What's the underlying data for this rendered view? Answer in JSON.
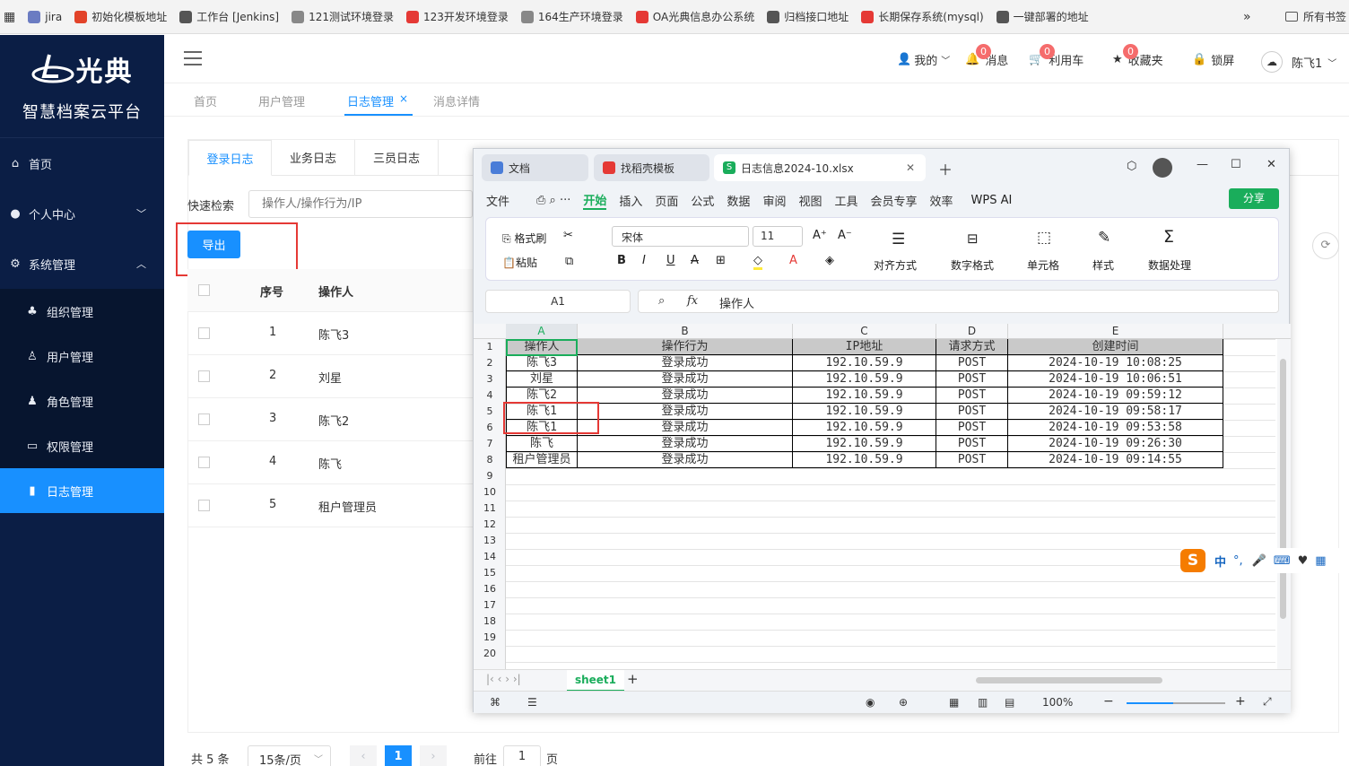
{
  "bookmarks": [
    "jira",
    "初始化模板地址",
    "工作台 [Jenkins]",
    "121测试环境登录",
    "123开发环境登录",
    "164生产环境登录",
    "OA光典信息办公系统",
    "归档接口地址",
    "长期保存系统(mysql)",
    "一键部署的地址"
  ],
  "bookmarks_more": "»",
  "bookmarks_all": "所有书签",
  "brand": {
    "logo": "光典",
    "platform": "智慧档案云平台"
  },
  "sidebar": {
    "items": [
      {
        "label": "首页"
      },
      {
        "label": "个人中心"
      },
      {
        "label": "系统管理"
      }
    ],
    "sub": [
      {
        "label": "组织管理"
      },
      {
        "label": "用户管理"
      },
      {
        "label": "角色管理"
      },
      {
        "label": "权限管理"
      },
      {
        "label": "日志管理"
      }
    ]
  },
  "header": {
    "mine": "我的",
    "messages": "消息",
    "utilize": "利用车",
    "favorites": "收藏夹",
    "lock": "锁屏",
    "user": "陈飞1",
    "badge_messages": "0",
    "badge_utilize": "0",
    "badge_favorites": "0"
  },
  "page_tabs": [
    "首页",
    "用户管理",
    "日志管理",
    "消息详情"
  ],
  "page_tab_close": "×",
  "log_tabs": [
    "登录日志",
    "业务日志",
    "三员日志"
  ],
  "search": {
    "label": "快速检索",
    "placeholder": "操作人/操作行为/IP"
  },
  "export_label": "导出",
  "table": {
    "headers": [
      "序号",
      "操作人"
    ],
    "rows": [
      {
        "no": "1",
        "user": "陈飞3"
      },
      {
        "no": "2",
        "user": "刘星"
      },
      {
        "no": "3",
        "user": "陈飞2"
      },
      {
        "no": "4",
        "user": "陈飞"
      },
      {
        "no": "5",
        "user": "租户管理员"
      }
    ]
  },
  "pagination": {
    "total": "共 5 条",
    "page_size": "15条/页",
    "current": "1",
    "goto": "前往",
    "goto_value": "1",
    "page_suffix": "页"
  },
  "wps": {
    "tabs": [
      "文档",
      "找稻壳模板",
      "日志信息2024-10.xlsx"
    ],
    "menu": [
      "文件",
      "开始",
      "插入",
      "页面",
      "公式",
      "数据",
      "审阅",
      "视图",
      "工具",
      "会员专享",
      "效率",
      "WPS AI"
    ],
    "share": "分享",
    "ribbon": {
      "format_painter": "格式刷",
      "paste": "粘贴",
      "font": "宋体",
      "size": "11",
      "align": "对齐方式",
      "number": "数字格式",
      "cells": "单元格",
      "style": "样式",
      "dataproc": "数据处理"
    },
    "namebox": "A1",
    "fx": "fx",
    "formula": "操作人",
    "columns": [
      "A",
      "B",
      "C",
      "D",
      "E"
    ],
    "sheet": {
      "header": [
        "操作人",
        "操作行为",
        "IP地址",
        "请求方式",
        "创建时间"
      ],
      "rows": [
        [
          "陈飞3",
          "登录成功",
          "192.10.59.9",
          "POST",
          "2024-10-19 10:08:25"
        ],
        [
          "刘星",
          "登录成功",
          "192.10.59.9",
          "POST",
          "2024-10-19 10:06:51"
        ],
        [
          "陈飞2",
          "登录成功",
          "192.10.59.9",
          "POST",
          "2024-10-19 09:59:12"
        ],
        [
          "陈飞1",
          "登录成功",
          "192.10.59.9",
          "POST",
          "2024-10-19 09:58:17"
        ],
        [
          "陈飞1",
          "登录成功",
          "192.10.59.9",
          "POST",
          "2024-10-19 09:53:58"
        ],
        [
          "陈飞",
          "登录成功",
          "192.10.59.9",
          "POST",
          "2024-10-19 09:26:30"
        ],
        [
          "租户管理员",
          "登录成功",
          "192.10.59.9",
          "POST",
          "2024-10-19 09:14:55"
        ]
      ]
    },
    "row_numbers": [
      "1",
      "2",
      "3",
      "4",
      "5",
      "6",
      "7",
      "8",
      "9",
      "10",
      "11",
      "12",
      "13",
      "14",
      "15",
      "16",
      "17",
      "18",
      "19",
      "20"
    ],
    "sheet_tab": "sheet1",
    "zoom": "100%"
  },
  "ime": "中"
}
